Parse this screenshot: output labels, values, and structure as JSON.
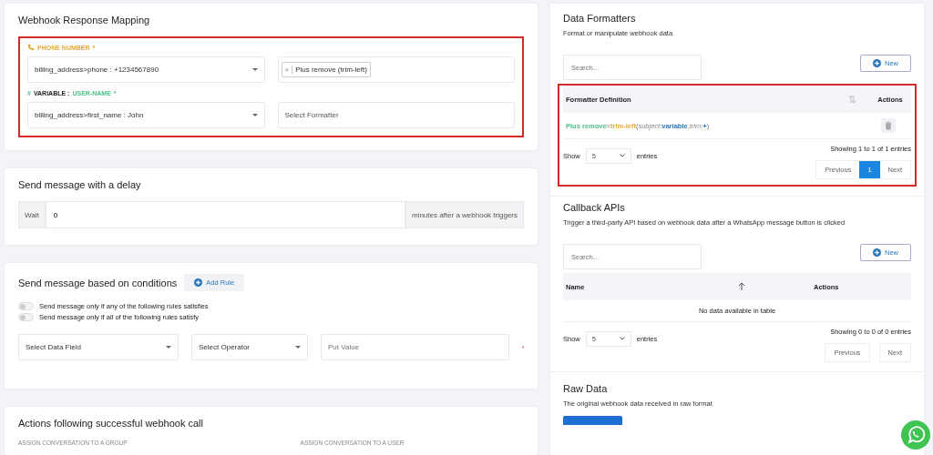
{
  "mapping": {
    "title": "Webhook Response Mapping",
    "groups": [
      {
        "kind": "phone",
        "label": "PHONE NUMBER",
        "required": "*",
        "field": "billing_address>phone : +1234567890",
        "formatter_tags": [
          {
            "remove": "×",
            "label": "Plus remove (trim-left)"
          }
        ]
      },
      {
        "kind": "variable",
        "symbol": "#",
        "label": "VARIABLE :",
        "label_extra": "USER-NAME",
        "required": "*",
        "field": "billing_address>first_name : John",
        "formatter_placeholder": "Select Formatter"
      }
    ]
  },
  "delay": {
    "title": "Send message with a delay",
    "prefix": "Wait",
    "value": "0",
    "suffix": "minutes after a webhook triggers"
  },
  "conditions": {
    "title": "Send message based on conditions",
    "add_button": "Add Rule",
    "toggles": [
      {
        "label": "Send message only if any of the following rules satisfies",
        "on": false
      },
      {
        "label": "Send message only if all of the following rules satisfy",
        "on": false
      }
    ],
    "rule": {
      "field": "Select Data Field",
      "operator": "Select Operator",
      "value_placeholder": "Put Value"
    }
  },
  "actions": {
    "title": "Actions following successful webhook call",
    "labels": [
      "ASSIGN CONVERSATION TO A GROUP",
      "ASSIGN CONVERSATION TO A USER"
    ]
  },
  "formatters": {
    "title": "Data Formatters",
    "subtitle": "Format or manipulate webhook data",
    "search_placeholder": "Search...",
    "new_button": "New",
    "columns": [
      "Formatter Definition",
      "Actions"
    ],
    "rows": [
      {
        "parts": [
          {
            "kind": "name",
            "text": "Plus remove"
          },
          {
            "kind": "op",
            "text": "="
          },
          {
            "kind": "func",
            "text": "trim-left"
          },
          {
            "kind": "punct",
            "text": "("
          },
          {
            "kind": "param",
            "text": "subject"
          },
          {
            "kind": "punct",
            "text": ":"
          },
          {
            "kind": "value",
            "text": "variable"
          },
          {
            "kind": "punct",
            "text": ","
          },
          {
            "kind": "param",
            "text": "trim"
          },
          {
            "kind": "punct",
            "text": ":"
          },
          {
            "kind": "value",
            "text": "+"
          },
          {
            "kind": "punct",
            "text": ")"
          }
        ]
      }
    ],
    "show": "Show",
    "page_size": "5",
    "entries": "entries",
    "info": "Showing 1 to 1 of 1 entries",
    "pages": [
      {
        "label": "Previous",
        "selected": false
      },
      {
        "label": "1",
        "selected": true
      },
      {
        "label": "Next",
        "selected": false
      }
    ]
  },
  "callbacks": {
    "title": "Callback APIs",
    "subtitle": "Trigger a third-party API based on webhook data after a WhatsApp message button is clicked",
    "search_placeholder": "Search...",
    "new_button": "New",
    "columns": [
      "Name",
      "Actions"
    ],
    "empty": "No data available in table",
    "show": "Show",
    "page_size": "5",
    "entries": "entries",
    "info": "Showing 0 to 0 of 0 entries",
    "pages": [
      {
        "label": "Previous",
        "selected": false
      },
      {
        "label": "Next",
        "selected": false
      }
    ]
  },
  "raw": {
    "title": "Raw Data",
    "subtitle": "The original webhook data received in raw format"
  }
}
